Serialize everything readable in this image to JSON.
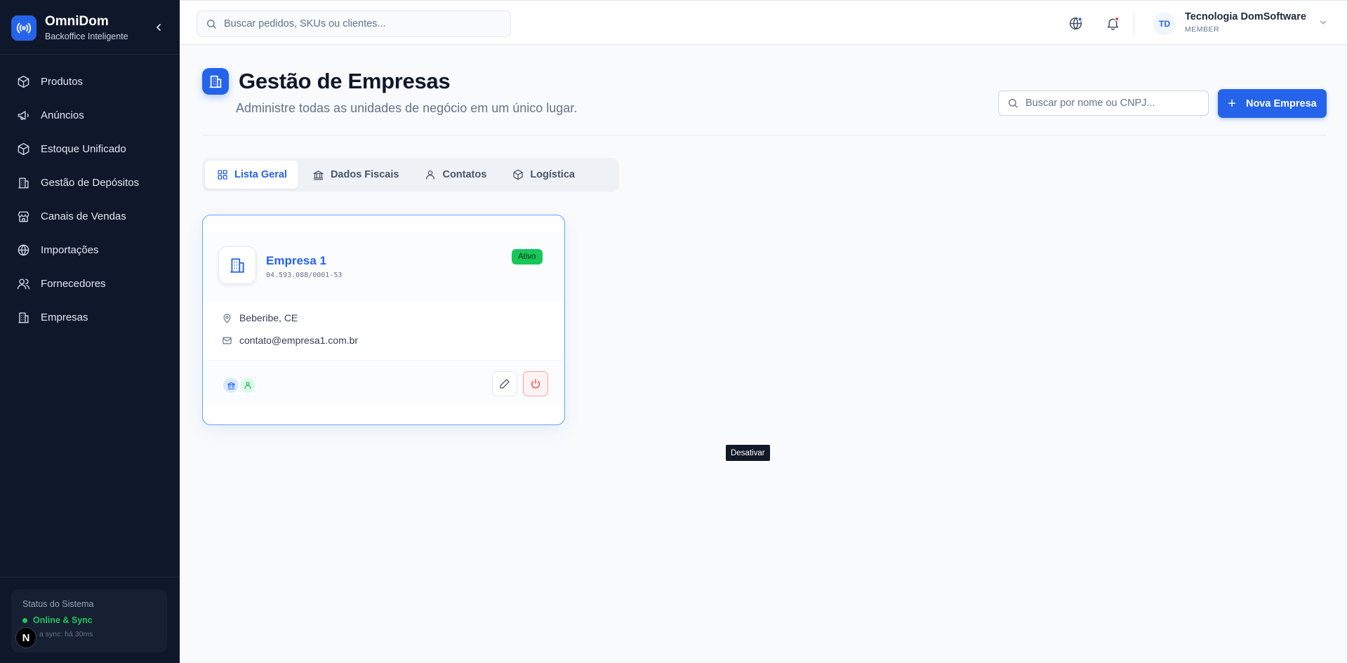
{
  "brand": {
    "name": "OmniDom",
    "subtitle": "Backoffice Inteligente"
  },
  "sidebar": {
    "items": [
      {
        "label": "Produtos",
        "icon": "box-icon"
      },
      {
        "label": "Anúncios",
        "icon": "megaphone-icon"
      },
      {
        "label": "Estoque Unificado",
        "icon": "box-icon"
      },
      {
        "label": "Gestão de Depósitos",
        "icon": "building-icon"
      },
      {
        "label": "Canais de Vendas",
        "icon": "store-icon"
      },
      {
        "label": "Importações",
        "icon": "globe-icon"
      },
      {
        "label": "Fornecedores",
        "icon": "users-icon"
      },
      {
        "label": "Empresas",
        "icon": "building-icon"
      }
    ],
    "status": {
      "title": "Status do Sistema",
      "state": "Online & Sync",
      "sync": "a sync: há 30ms"
    },
    "next_badge": "N"
  },
  "topbar": {
    "search_placeholder": "Buscar pedidos, SKUs ou clientes...",
    "user": {
      "initials": "TD",
      "name": "Tecnologia DomSoftware",
      "role": "MEMBER"
    }
  },
  "page": {
    "title": "Gestão de Empresas",
    "subtitle": "Administre todas as unidades de negócio em um único lugar.",
    "search_placeholder": "Buscar por nome ou CNPJ...",
    "new_button": "Nova Empresa"
  },
  "tabs": [
    {
      "label": "Lista Geral",
      "icon": "grid-icon",
      "active": true
    },
    {
      "label": "Dados Fiscais",
      "icon": "bank-icon",
      "active": false
    },
    {
      "label": "Contatos",
      "icon": "user-icon",
      "active": false
    },
    {
      "label": "Logística",
      "icon": "box-icon",
      "active": false
    }
  ],
  "companies": [
    {
      "name": "Empresa 1",
      "cnpj": "04.593.088/0001-53",
      "status": "Ativo",
      "location": "Beberibe, CE",
      "email": "contato@empresa1.com.br",
      "tooltip": "Desativar"
    }
  ],
  "colors": {
    "accent": "#2563eb",
    "sidebar_bg": "#0f172a",
    "active_badge": "#16c75a",
    "danger": "#ef4444",
    "online": "#22c55e"
  }
}
